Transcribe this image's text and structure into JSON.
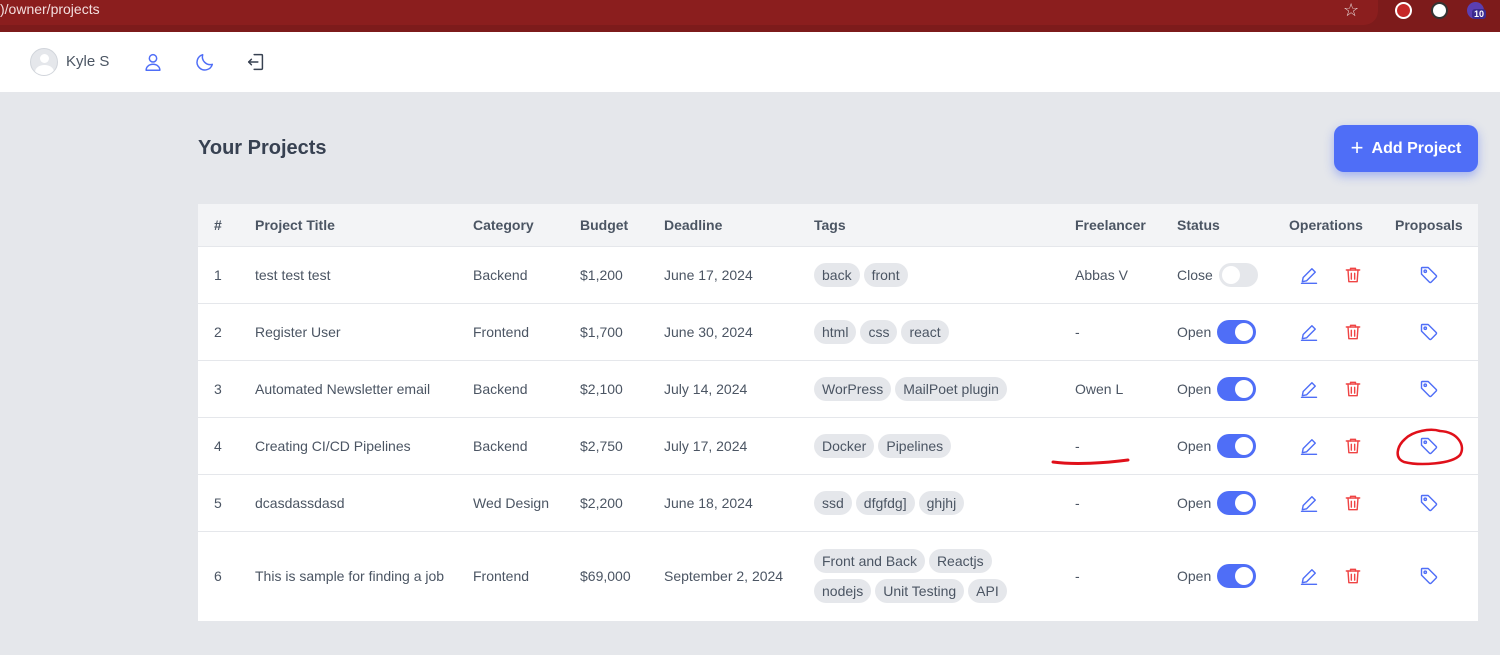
{
  "browser": {
    "url": ")/owner/projects",
    "badge": "10"
  },
  "header": {
    "username": "Kyle S"
  },
  "page": {
    "title": "Your Projects",
    "add_button": "Add Project"
  },
  "table": {
    "headers": [
      "#",
      "Project Title",
      "Category",
      "Budget",
      "Deadline",
      "Tags",
      "Freelancer",
      "Status",
      "Operations",
      "Proposals"
    ],
    "rows": [
      {
        "num": "1",
        "title": "test test test",
        "category": "Backend",
        "budget": "$1,200",
        "deadline": "June 17, 2024",
        "tags": [
          "back",
          "front"
        ],
        "freelancer": "Abbas V",
        "status": "Close",
        "toggle_on": false
      },
      {
        "num": "2",
        "title": "Register User",
        "category": "Frontend",
        "budget": "$1,700",
        "deadline": "June 30, 2024",
        "tags": [
          "html",
          "css",
          "react"
        ],
        "freelancer": "-",
        "status": "Open",
        "toggle_on": true
      },
      {
        "num": "3",
        "title": "Automated Newsletter email",
        "category": "Backend",
        "budget": "$2,100",
        "deadline": "July 14, 2024",
        "tags": [
          "WorPress",
          "MailPoet plugin"
        ],
        "freelancer": "Owen L",
        "status": "Open",
        "toggle_on": true
      },
      {
        "num": "4",
        "title": "Creating CI/CD Pipelines",
        "category": "Backend",
        "budget": "$2,750",
        "deadline": "July 17, 2024",
        "tags": [
          "Docker",
          "Pipelines"
        ],
        "freelancer": "-",
        "status": "Open",
        "toggle_on": true
      },
      {
        "num": "5",
        "title": "dcasdassdasd",
        "category": "Wed Design",
        "budget": "$2,200",
        "deadline": "June 18, 2024",
        "tags": [
          "ssd",
          "dfgfdg]",
          "ghjhj"
        ],
        "freelancer": "-",
        "status": "Open",
        "toggle_on": true
      },
      {
        "num": "6",
        "title": "This is sample for finding a job",
        "category": "Frontend",
        "budget": "$69,000",
        "deadline": "September 2, 2024",
        "tags": [
          "Front and Back",
          "Reactjs",
          "nodejs",
          "Unit Testing",
          "API"
        ],
        "freelancer": "-",
        "status": "Open",
        "toggle_on": true
      }
    ]
  },
  "colors": {
    "accent": "#4f6ef7",
    "danger": "#ef4444",
    "chrome": "#7d1b1b",
    "annotation": "#e0101a"
  },
  "icons": {
    "profile": "user-icon",
    "theme": "moon-icon",
    "logout": "logout-icon",
    "edit": "pencil-icon",
    "delete": "trash-icon",
    "proposals": "tag-icon"
  }
}
